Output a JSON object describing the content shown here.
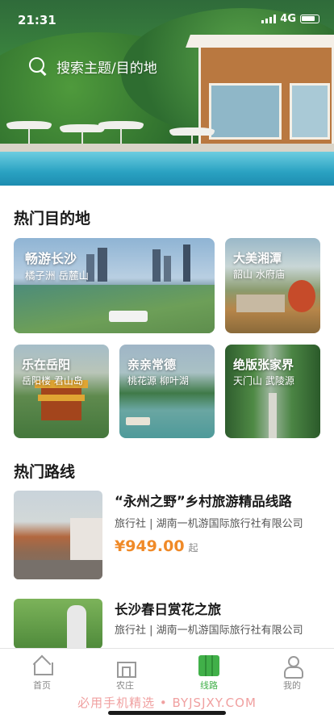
{
  "status_bar": {
    "time": "21:31",
    "network": "4G"
  },
  "search": {
    "placeholder": "搜索主题/目的地"
  },
  "destinations": {
    "title": "热门目的地",
    "items": [
      {
        "name": "畅游长沙",
        "spots": "橘子洲 岳麓山"
      },
      {
        "name": "大美湘潭",
        "spots": "韶山 水府庙"
      },
      {
        "name": "乐在岳阳",
        "spots": "岳阳楼 君山岛"
      },
      {
        "name": "亲亲常德",
        "spots": "桃花源 柳叶湖"
      },
      {
        "name": "绝版张家界",
        "spots": "天门山 武陵源"
      }
    ]
  },
  "routes": {
    "title": "热门路线",
    "items": [
      {
        "title": "“永州之野”乡村旅游精品线路",
        "agency": "旅行社 | 湖南一机游国际旅行社有限公司",
        "price": "¥949.00",
        "price_unit": "起"
      },
      {
        "title": "长沙春日赏花之旅",
        "agency": "旅行社 | 湖南一机游国际旅行社有限公司"
      }
    ]
  },
  "tabbar": {
    "items": [
      {
        "label": "首页",
        "icon": "home-icon"
      },
      {
        "label": "农庄",
        "icon": "farm-icon"
      },
      {
        "label": "线路",
        "icon": "map-icon",
        "active": true
      },
      {
        "label": "我的",
        "icon": "profile-icon"
      }
    ],
    "active_color": "#41b049"
  },
  "watermark": "必用手机精选 • BYJSJXY.COM",
  "colors": {
    "accent": "#41b049",
    "price": "#f08a28"
  }
}
